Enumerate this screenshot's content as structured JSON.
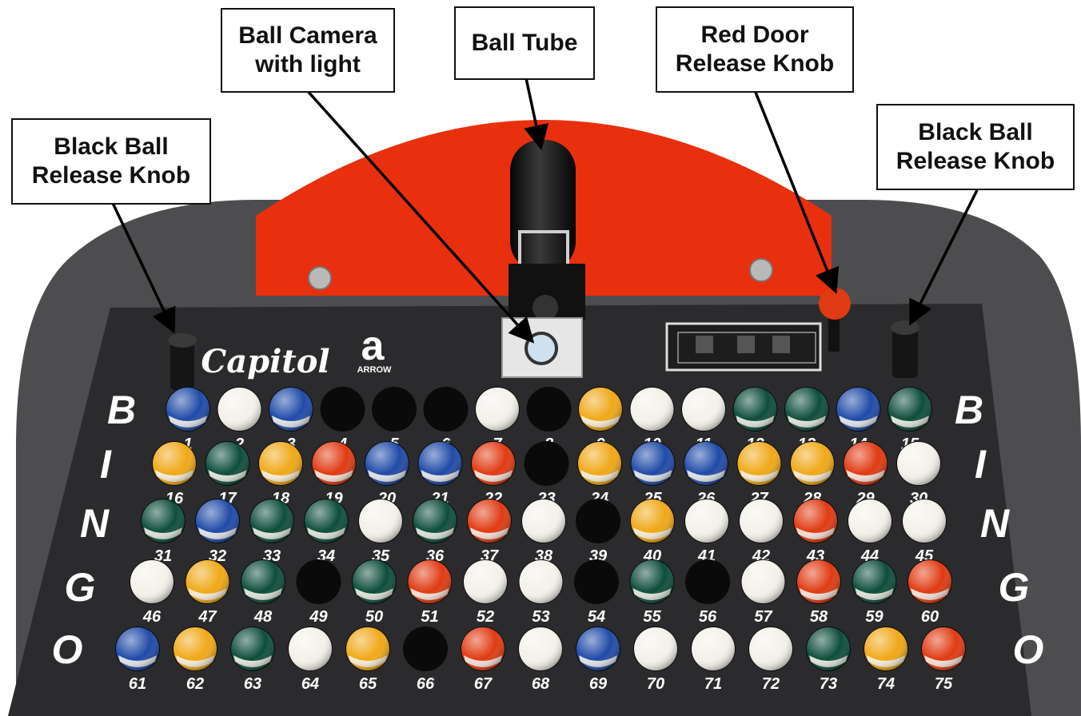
{
  "callouts": [
    {
      "id": "ball-camera",
      "text": "Ball Camera\nwith light"
    },
    {
      "id": "ball-tube",
      "text": "Ball Tube"
    },
    {
      "id": "red-door",
      "text": "Red Door\nRelease Knob"
    },
    {
      "id": "black-ball-left",
      "text": "Black Ball\nRelease Knob"
    },
    {
      "id": "black-ball-right",
      "text": "Black Ball\nRelease Knob"
    }
  ],
  "bingo_letters": [
    "B",
    "I",
    "N",
    "G",
    "O"
  ],
  "board": {
    "brand": "Capitol",
    "logo_letter": "a",
    "logo_text": "ARROW"
  },
  "balls": [
    {
      "n": 1,
      "c": "blue"
    },
    {
      "n": 2,
      "c": "white"
    },
    {
      "n": 3,
      "c": "blue"
    },
    {
      "n": 4,
      "c": "empty"
    },
    {
      "n": 5,
      "c": "empty"
    },
    {
      "n": 6,
      "c": "empty"
    },
    {
      "n": 7,
      "c": "white"
    },
    {
      "n": 8,
      "c": "empty"
    },
    {
      "n": 9,
      "c": "yellow"
    },
    {
      "n": 10,
      "c": "white"
    },
    {
      "n": 11,
      "c": "white"
    },
    {
      "n": 12,
      "c": "green"
    },
    {
      "n": 13,
      "c": "green"
    },
    {
      "n": 14,
      "c": "blue"
    },
    {
      "n": 15,
      "c": "green"
    },
    {
      "n": 16,
      "c": "yellow"
    },
    {
      "n": 17,
      "c": "green"
    },
    {
      "n": 18,
      "c": "yellow"
    },
    {
      "n": 19,
      "c": "red"
    },
    {
      "n": 20,
      "c": "blue"
    },
    {
      "n": 21,
      "c": "blue"
    },
    {
      "n": 22,
      "c": "red"
    },
    {
      "n": 23,
      "c": "empty"
    },
    {
      "n": 24,
      "c": "yellow"
    },
    {
      "n": 25,
      "c": "blue"
    },
    {
      "n": 26,
      "c": "blue"
    },
    {
      "n": 27,
      "c": "yellow"
    },
    {
      "n": 28,
      "c": "yellow"
    },
    {
      "n": 29,
      "c": "red"
    },
    {
      "n": 30,
      "c": "white"
    },
    {
      "n": 31,
      "c": "green"
    },
    {
      "n": 32,
      "c": "blue"
    },
    {
      "n": 33,
      "c": "green"
    },
    {
      "n": 34,
      "c": "green"
    },
    {
      "n": 35,
      "c": "white"
    },
    {
      "n": 36,
      "c": "green"
    },
    {
      "n": 37,
      "c": "red"
    },
    {
      "n": 38,
      "c": "white"
    },
    {
      "n": 39,
      "c": "empty"
    },
    {
      "n": 40,
      "c": "yellow"
    },
    {
      "n": 41,
      "c": "white"
    },
    {
      "n": 42,
      "c": "white"
    },
    {
      "n": 43,
      "c": "red"
    },
    {
      "n": 44,
      "c": "white"
    },
    {
      "n": 45,
      "c": "white"
    },
    {
      "n": 46,
      "c": "white"
    },
    {
      "n": 47,
      "c": "yellow"
    },
    {
      "n": 48,
      "c": "green"
    },
    {
      "n": 49,
      "c": "empty"
    },
    {
      "n": 50,
      "c": "green"
    },
    {
      "n": 51,
      "c": "red"
    },
    {
      "n": 52,
      "c": "white"
    },
    {
      "n": 53,
      "c": "white"
    },
    {
      "n": 54,
      "c": "empty"
    },
    {
      "n": 55,
      "c": "green"
    },
    {
      "n": 56,
      "c": "empty"
    },
    {
      "n": 57,
      "c": "white"
    },
    {
      "n": 58,
      "c": "red"
    },
    {
      "n": 59,
      "c": "green"
    },
    {
      "n": 60,
      "c": "red"
    },
    {
      "n": 61,
      "c": "blue"
    },
    {
      "n": 62,
      "c": "yellow"
    },
    {
      "n": 63,
      "c": "green"
    },
    {
      "n": 64,
      "c": "white"
    },
    {
      "n": 65,
      "c": "yellow"
    },
    {
      "n": 66,
      "c": "empty"
    },
    {
      "n": 67,
      "c": "red"
    },
    {
      "n": 68,
      "c": "white"
    },
    {
      "n": 69,
      "c": "blue"
    },
    {
      "n": 70,
      "c": "white"
    },
    {
      "n": 71,
      "c": "white"
    },
    {
      "n": 72,
      "c": "white"
    },
    {
      "n": 73,
      "c": "green"
    },
    {
      "n": 74,
      "c": "yellow"
    },
    {
      "n": 75,
      "c": "red"
    }
  ],
  "colors": {
    "board": "#2b2b2d",
    "carpet": "#4d4d4f",
    "red_panel": "#e8300e",
    "ball_white": "#f4f1ea",
    "ball_yellow": "#f0a818",
    "ball_red": "#e03a12",
    "ball_blue": "#1f4aa8",
    "ball_green": "#0d4d3a",
    "hole": "#0a0a0a",
    "text": "#ffffff"
  }
}
